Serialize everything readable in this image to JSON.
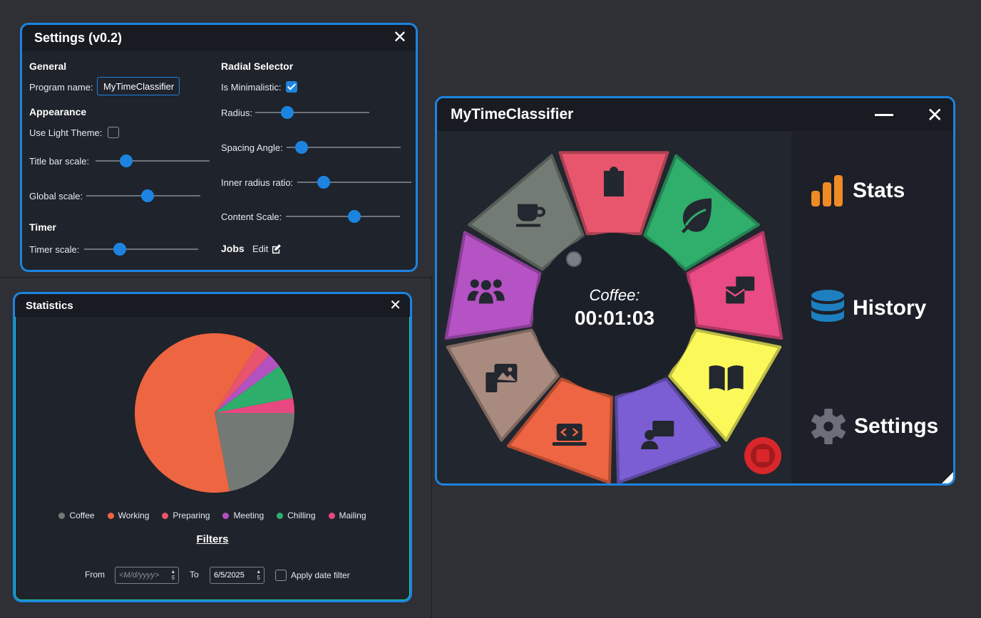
{
  "settings": {
    "title": "Settings (v0.2)",
    "general": {
      "heading": "General",
      "program_name_label": "Program name:",
      "program_name_value": "MyTimeClassifier"
    },
    "appearance": {
      "heading": "Appearance",
      "light_theme_label": "Use Light Theme:",
      "light_theme_checked": false,
      "title_bar_scale_label": "Title bar scale:",
      "title_bar_scale_value": 0.27,
      "global_scale_label": "Global scale:",
      "global_scale_value": 0.54
    },
    "timer": {
      "heading": "Timer",
      "timer_scale_label": "Timer scale:",
      "timer_scale_value": 0.31
    },
    "radial": {
      "heading": "Radial Selector",
      "minimalistic_label": "Is Minimalistic:",
      "minimalistic_checked": true,
      "radius_label": "Radius:",
      "radius_value": 0.28,
      "spacing_label": "Spacing Angle:",
      "spacing_value": 0.13,
      "inner_ratio_label": "Inner radius ratio:",
      "inner_ratio_value": 0.23,
      "content_scale_label": "Content Scale:",
      "content_scale_value": 0.6
    },
    "jobs": {
      "heading": "Jobs",
      "edit_label": "Edit"
    }
  },
  "statistics": {
    "title": "Statistics",
    "filters_title": "Filters",
    "from_label": "From",
    "from_placeholder": "<M/d/yyyy>",
    "from_spin": "5",
    "to_label": "To",
    "to_value": "6/5/2025",
    "to_spin": "5",
    "apply_label": "Apply date filter",
    "apply_checked": false
  },
  "chart_data": {
    "type": "pie",
    "categories": [
      "Coffee",
      "Working",
      "Preparing",
      "Meeting",
      "Chilling",
      "Mailing"
    ],
    "values": [
      22,
      62,
      3,
      3,
      7,
      3
    ],
    "colors": [
      "#737a76",
      "#ee6541",
      "#e8546e",
      "#b451c0",
      "#2eae6b",
      "#e84880"
    ],
    "legend": "bottom"
  },
  "main": {
    "title": "MyTimeClassifier",
    "current_job": "Coffee:",
    "timer": "00:01:03",
    "nav": {
      "stats": "Stats",
      "history": "History",
      "settings": "Settings"
    },
    "segments": [
      {
        "name": "coffee",
        "color": "#737b75",
        "icon": "coffee-cup-icon"
      },
      {
        "name": "preparing",
        "color": "#e8566e",
        "icon": "clipboard-list-icon"
      },
      {
        "name": "chilling",
        "color": "#2fae6c",
        "icon": "leaf-icon"
      },
      {
        "name": "mailing",
        "color": "#e94b84",
        "icon": "mail-stack-icon"
      },
      {
        "name": "reading",
        "color": "#fbf95a",
        "icon": "book-icon"
      },
      {
        "name": "teaching",
        "color": "#7b5ed4",
        "icon": "presentation-icon"
      },
      {
        "name": "working",
        "color": "#ee6543",
        "icon": "laptop-code-icon"
      },
      {
        "name": "media",
        "color": "#a98a7f",
        "icon": "photo-film-icon"
      },
      {
        "name": "meeting",
        "color": "#b552c4",
        "icon": "people-group-icon"
      }
    ]
  }
}
